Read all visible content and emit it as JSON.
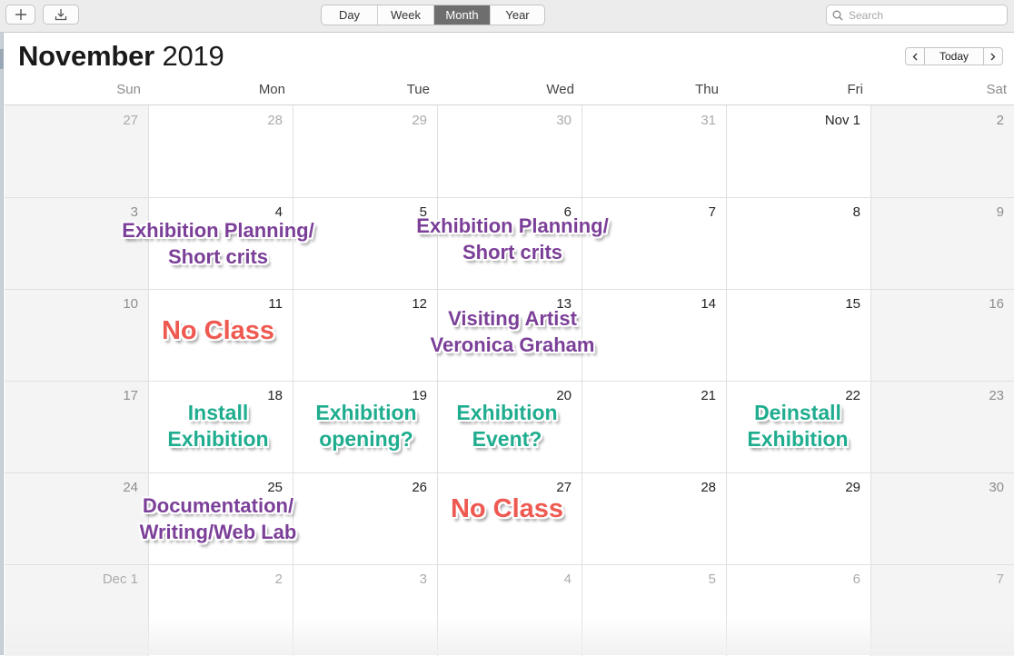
{
  "toolbar": {
    "add_icon": "plus-icon",
    "import_icon": "download-tray-icon",
    "views": [
      "Day",
      "Week",
      "Month",
      "Year"
    ],
    "active_view": "Month",
    "search_placeholder": "Search",
    "search_value": ""
  },
  "header": {
    "month": "November",
    "year": "2019",
    "prev_icon": "chevron-left-icon",
    "today_label": "Today",
    "next_icon": "chevron-right-icon"
  },
  "weekdays": [
    "Sun",
    "Mon",
    "Tue",
    "Wed",
    "Thu",
    "Fri",
    "Sat"
  ],
  "weeks": [
    [
      {
        "label": "27",
        "dim": true
      },
      {
        "label": "28",
        "dim": true
      },
      {
        "label": "29",
        "dim": true
      },
      {
        "label": "30",
        "dim": true
      },
      {
        "label": "31",
        "dim": true
      },
      {
        "label": "Nov 1",
        "dim": false
      },
      {
        "label": "2",
        "dim": false
      }
    ],
    [
      {
        "label": "3",
        "dim": false
      },
      {
        "label": "4",
        "dim": false
      },
      {
        "label": "5",
        "dim": false
      },
      {
        "label": "6",
        "dim": false
      },
      {
        "label": "7",
        "dim": false
      },
      {
        "label": "8",
        "dim": false
      },
      {
        "label": "9",
        "dim": false
      }
    ],
    [
      {
        "label": "10",
        "dim": false
      },
      {
        "label": "11",
        "dim": false
      },
      {
        "label": "12",
        "dim": false
      },
      {
        "label": "13",
        "dim": false
      },
      {
        "label": "14",
        "dim": false
      },
      {
        "label": "15",
        "dim": false
      },
      {
        "label": "16",
        "dim": false
      }
    ],
    [
      {
        "label": "17",
        "dim": false
      },
      {
        "label": "18",
        "dim": false
      },
      {
        "label": "19",
        "dim": false
      },
      {
        "label": "20",
        "dim": false
      },
      {
        "label": "21",
        "dim": false
      },
      {
        "label": "22",
        "dim": false
      },
      {
        "label": "23",
        "dim": false
      }
    ],
    [
      {
        "label": "24",
        "dim": false
      },
      {
        "label": "25",
        "dim": false
      },
      {
        "label": "26",
        "dim": false
      },
      {
        "label": "27",
        "dim": false
      },
      {
        "label": "28",
        "dim": false
      },
      {
        "label": "29",
        "dim": false
      },
      {
        "label": "30",
        "dim": false
      }
    ],
    [
      {
        "label": "Dec 1",
        "dim": true
      },
      {
        "label": "2",
        "dim": true
      },
      {
        "label": "3",
        "dim": true
      },
      {
        "label": "4",
        "dim": true
      },
      {
        "label": "5",
        "dim": true
      },
      {
        "label": "6",
        "dim": true
      },
      {
        "label": "7",
        "dim": true
      }
    ]
  ],
  "annotations": [
    {
      "day": "Nov 4",
      "lines": [
        "Exhibition Planning/",
        "Short crits"
      ],
      "color": "purple"
    },
    {
      "day": "Nov 6",
      "lines": [
        "Exhibition Planning/",
        "Short crits"
      ],
      "color": "purple"
    },
    {
      "day": "Nov 11",
      "lines": [
        "No Class"
      ],
      "color": "red"
    },
    {
      "day": "Nov 13",
      "lines": [
        "Visiting Artist",
        "Veronica Graham"
      ],
      "color": "purple"
    },
    {
      "day": "Nov 18",
      "lines": [
        "Install",
        "Exhibition"
      ],
      "color": "teal"
    },
    {
      "day": "Nov 19",
      "lines": [
        "Exhibition",
        "opening?"
      ],
      "color": "teal"
    },
    {
      "day": "Nov 20",
      "lines": [
        "Exhibition",
        "Event?"
      ],
      "color": "teal"
    },
    {
      "day": "Nov 22",
      "lines": [
        "Deinstall",
        "Exhibition"
      ],
      "color": "teal"
    },
    {
      "day": "Nov 25",
      "lines": [
        "Documentation/",
        "Writing/Web Lab"
      ],
      "color": "purple"
    },
    {
      "day": "Nov 27",
      "lines": [
        "No Class"
      ],
      "color": "red"
    }
  ],
  "colors": {
    "purple": "#7b3f98",
    "teal": "#20ad8f",
    "red": "#ee5a52",
    "active_segment": "#6e6e6e",
    "weekend_bg": "#f4f4f4"
  }
}
